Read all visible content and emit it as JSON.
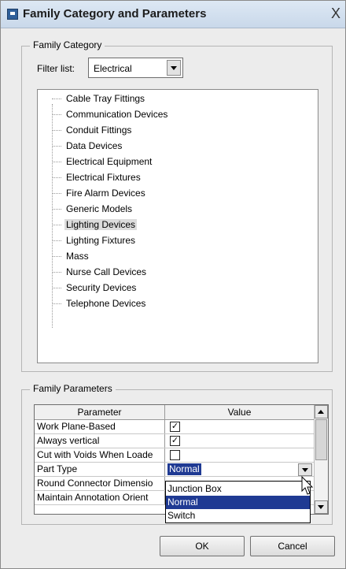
{
  "window": {
    "title": "Family Category and Parameters",
    "close_label": "X"
  },
  "family_category": {
    "legend": "Family Category",
    "filter_label": "Filter list:",
    "filter_value": "Electrical",
    "items": [
      "Cable Tray Fittings",
      "Communication Devices",
      "Conduit Fittings",
      "Data Devices",
      "Electrical Equipment",
      "Electrical Fixtures",
      "Fire Alarm Devices",
      "Generic Models",
      "Lighting Devices",
      "Lighting Fixtures",
      "Mass",
      "Nurse Call Devices",
      "Security Devices",
      "Telephone Devices"
    ],
    "selected_item": "Lighting Devices"
  },
  "family_parameters": {
    "legend": "Family Parameters",
    "columns": [
      "Parameter",
      "Value"
    ],
    "rows": [
      {
        "name": "Work Plane-Based",
        "checked": true
      },
      {
        "name": "Always vertical",
        "checked": true
      },
      {
        "name": "Cut with Voids When Loade",
        "checked": false
      },
      {
        "name": "Part Type",
        "value": "Normal"
      },
      {
        "name": "Round Connector Dimensio"
      },
      {
        "name": "Maintain Annotation Orient"
      }
    ],
    "dropdown_options": [
      "Junction Box",
      "Normal",
      "Switch"
    ],
    "dropdown_selected": "Normal"
  },
  "buttons": {
    "ok": "OK",
    "cancel": "Cancel"
  },
  "colors": {
    "selection": "#1f3a93",
    "dialog_bg": "#ececec"
  }
}
